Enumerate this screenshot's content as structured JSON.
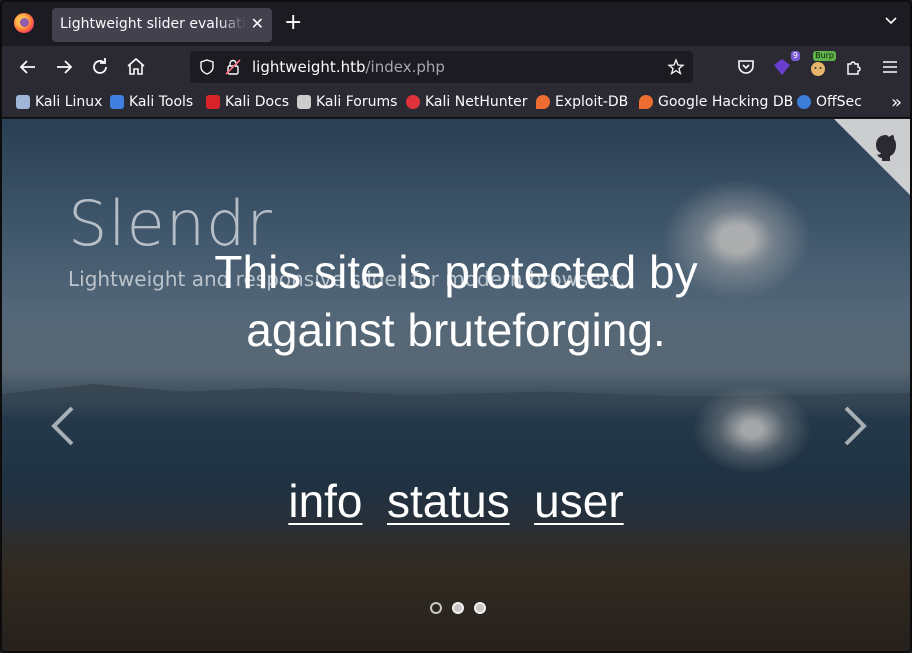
{
  "browser": {
    "tab": {
      "title": "Lightweight slider evaluation",
      "close": "✕"
    },
    "new_tab": "+",
    "url": {
      "host": "lightweight.htb",
      "path": "/index.php"
    },
    "extensions": {
      "notification_count": "9",
      "burp_label": "Burp"
    },
    "bookmarks": [
      {
        "label": "Kali Linux",
        "icon": "kali-dragon-icon",
        "color": "#9fb6d8"
      },
      {
        "label": "Kali Tools",
        "icon": "kali-tools-icon",
        "color": "#3f7fe0"
      },
      {
        "label": "Kali Docs",
        "icon": "kali-docs-icon",
        "color": "#d8232a"
      },
      {
        "label": "Kali Forums",
        "icon": "kali-forums-icon",
        "color": "#cccccc"
      },
      {
        "label": "Kali NetHunter",
        "icon": "nethunter-icon",
        "color": "#e0323a"
      },
      {
        "label": "Exploit-DB",
        "icon": "exploit-db-icon",
        "color": "#ec6d2f"
      },
      {
        "label": "Google Hacking DB",
        "icon": "ghdb-icon",
        "color": "#ec6d2f"
      },
      {
        "label": "OffSec",
        "icon": "offsec-icon",
        "color": "#3b7dd8"
      }
    ],
    "bookmarks_overflow": "»"
  },
  "page": {
    "slider_title": "Slendr",
    "slider_subtitle": "Lightweight and responsive slider for modern browsers.",
    "notice": "This site is protected by against bruteforging.",
    "nav_links": [
      {
        "label": "info"
      },
      {
        "label": "status"
      },
      {
        "label": "user"
      }
    ],
    "slide_count": 3,
    "active_slide": 1,
    "corner_icon": "github-octocat-icon"
  }
}
